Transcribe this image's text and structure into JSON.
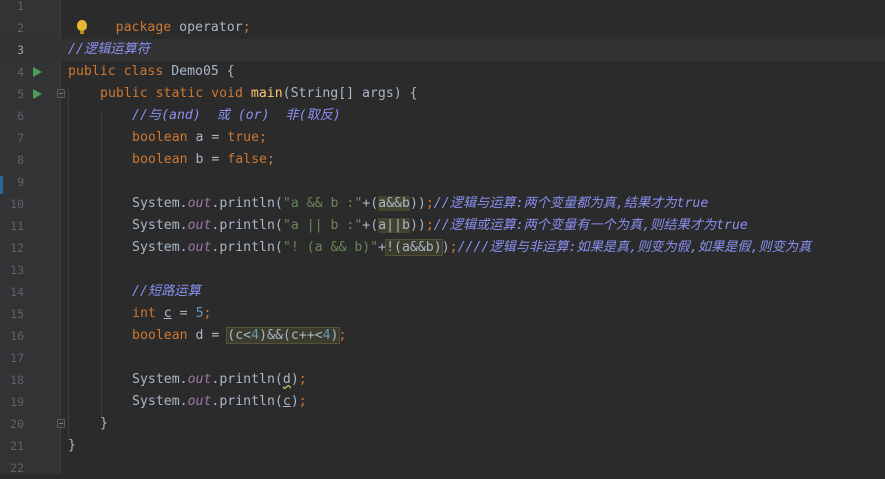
{
  "editor": {
    "line_numbers": [
      "1",
      "2",
      "3",
      "4",
      "5",
      "6",
      "7",
      "8",
      "9",
      "10",
      "11",
      "12",
      "13",
      "14",
      "15",
      "16",
      "17",
      "18",
      "19",
      "20",
      "21",
      "22"
    ],
    "current_line": "3",
    "lines": {
      "l1_kw": "package",
      "l1_rest": " operator",
      "l1_semi": ";",
      "l3_comment": "//逻辑运算符",
      "l4_kw": "public class",
      "l4_rest": " Demo05 {",
      "l5_kw": "public static void",
      "l5_fn": "main",
      "l5_rest": "(String[] args) {",
      "l6_comment": "//与(and)  或 (or)  非(取反)",
      "l7_kw": "boolean",
      "l7_mid": " a = ",
      "l7_val": "true",
      "l8_kw": "boolean",
      "l8_mid": " b = ",
      "l8_val": "false",
      "l10_pre": "System.",
      "l10_field": "out",
      "l10_call": ".println(",
      "l10_str": "\"a && b :\"",
      "l10_plus": "+(",
      "l10_expr": "a&&b",
      "l10_close": "))",
      "l10_comment": "//逻辑与运算:两个变量都为真,结果才为true",
      "l11_pre": "System.",
      "l11_field": "out",
      "l11_call": ".println(",
      "l11_str": "\"a || b :\"",
      "l11_plus": "+(",
      "l11_expr": "a||b",
      "l11_close": "))",
      "l11_comment": "//逻辑或运算:两个变量有一个为真,则结果才为true",
      "l12_pre": "System.",
      "l12_field": "out",
      "l12_call": ".println(",
      "l12_str": "\"! (a && b)\"",
      "l12_plus": "+",
      "l12_expr": "!(a&&b)",
      "l12_close": ")",
      "l12_comment": "////逻辑与非运算:如果是真,则变为假,如果是假,则变为真",
      "l14_comment": "//短路运算",
      "l15_kw": "int",
      "l15_var": "c",
      "l15_mid": " = ",
      "l15_num": "5",
      "l16_kw": "boolean",
      "l16_mid": " d = ",
      "l16_expr1": "(c<",
      "l16_n1": "4",
      "l16_expr2": ")&&(c++<",
      "l16_n2": "4",
      "l16_expr3": ")",
      "l18_pre": "System.",
      "l18_field": "out",
      "l18_call": ".println(",
      "l18_arg": "d",
      "l18_close": ")",
      "l19_pre": "System.",
      "l19_field": "out",
      "l19_call": ".println(",
      "l19_arg": "c",
      "l19_close": ")",
      "l20": "}",
      "l21": "}"
    }
  },
  "colors": {
    "background": "#2b2b2b",
    "keyword": "#cc7832",
    "string": "#6a8759",
    "number": "#6897bb",
    "comment": "#8a8ff0",
    "method": "#ffc66d",
    "field": "#9876aa"
  }
}
